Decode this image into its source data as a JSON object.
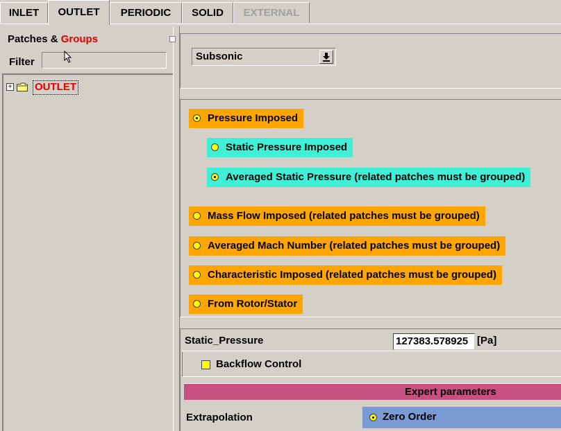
{
  "tabs": [
    {
      "label": "INLET",
      "state": "normal"
    },
    {
      "label": "OUTLET",
      "state": "active"
    },
    {
      "label": "PERIODIC",
      "state": "normal"
    },
    {
      "label": "SOLID",
      "state": "normal"
    },
    {
      "label": "EXTERNAL",
      "state": "disabled"
    }
  ],
  "left_panel": {
    "header_prefix": "Patches & ",
    "header_groups": "Groups",
    "filter_label": "Filter",
    "filter_value": "",
    "tree": [
      {
        "label": "OUTLET",
        "expanded": false
      }
    ]
  },
  "flow_type": {
    "selected": "Subsonic"
  },
  "options": {
    "pressure_imposed": "Pressure Imposed",
    "static_pressure_imposed": "Static Pressure Imposed",
    "averaged_static_pressure": "Averaged Static Pressure (related patches must be grouped)",
    "mass_flow_imposed": "Mass Flow Imposed (related patches must be grouped)",
    "averaged_mach": "Averaged Mach Number (related patches must be grouped)",
    "characteristic_imposed": "Characteristic Imposed (related patches must be grouped)",
    "from_rotor_stator": "From Rotor/Stator"
  },
  "selected_option": "pressure_imposed",
  "selected_sub_option": "averaged_static_pressure",
  "parameters": {
    "static_pressure_label": "Static_Pressure",
    "static_pressure_value": "127383.578925",
    "static_pressure_unit": "[Pa]",
    "backflow_label": "Backflow Control",
    "backflow_checked": false,
    "expert_label": "Expert parameters",
    "extrapolation_label": "Extrapolation",
    "extrapolation_value": "Zero Order"
  },
  "colors": {
    "orange_option": "#ffa500",
    "cyan_option": "#3ff0d6",
    "expert_bar": "#c85080",
    "extrapolation_bg": "#7a9ad6",
    "red_text": "#e00000"
  }
}
